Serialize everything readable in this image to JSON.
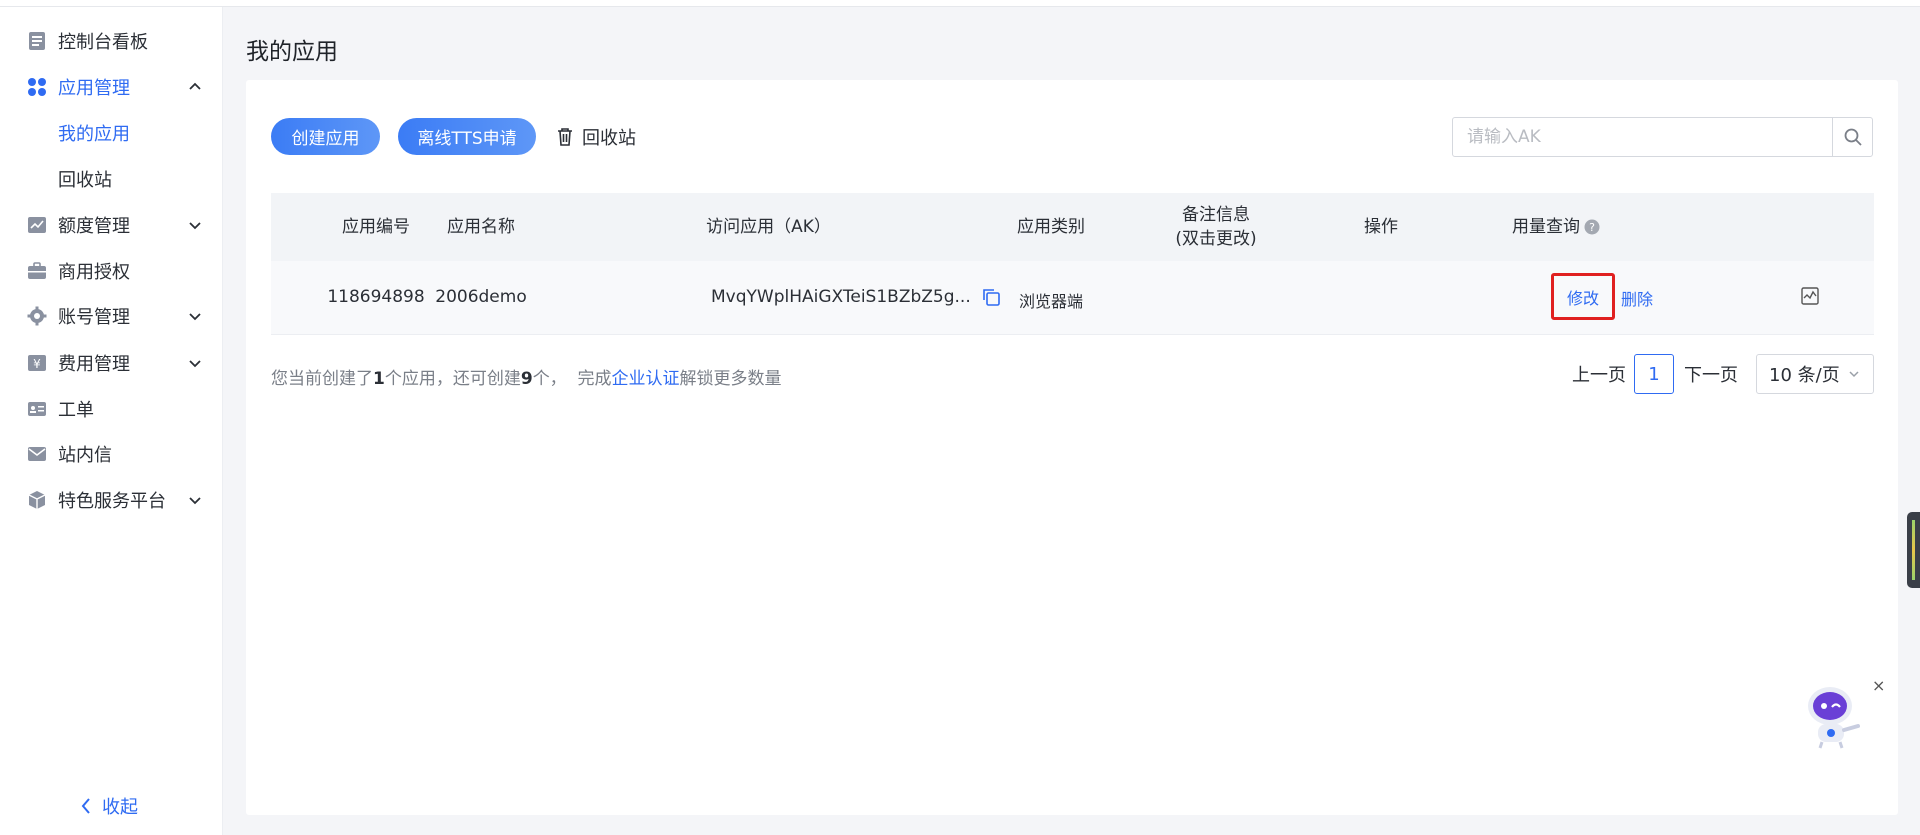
{
  "sidebar": {
    "items": [
      {
        "label": "控制台看板",
        "icon": "document-icon"
      },
      {
        "label": "应用管理",
        "icon": "apps-grid-icon",
        "expanded": true
      },
      {
        "label": "我的应用",
        "sub": true
      },
      {
        "label": "回收站",
        "sub": true
      },
      {
        "label": "额度管理",
        "icon": "chart-icon"
      },
      {
        "label": "商用授权",
        "icon": "briefcase-icon"
      },
      {
        "label": "账号管理",
        "icon": "gear-icon"
      },
      {
        "label": "费用管理",
        "icon": "yen-icon"
      },
      {
        "label": "工单",
        "icon": "id-card-icon"
      },
      {
        "label": "站内信",
        "icon": "mail-icon"
      },
      {
        "label": "特色服务平台",
        "icon": "cube-icon"
      }
    ],
    "collapse_label": "收起"
  },
  "page_title": "我的应用",
  "toolbar": {
    "create_label": "创建应用",
    "tts_label": "离线TTS申请",
    "recycle_label": "回收站",
    "search_placeholder": "请输入AK"
  },
  "table": {
    "headers": [
      "应用编号",
      "应用名称",
      "访问应用（AK）",
      "应用类别",
      "备注信息",
      "(双击更改)",
      "操作",
      "用量查询"
    ],
    "rows": [
      {
        "id": "118694898",
        "name": "2006demo",
        "ak": "MvqYWplHAiGXTeiS1BZbZ5g...",
        "category": "浏览器端",
        "remark": "",
        "edit_label": "修改",
        "delete_label": "删除"
      }
    ]
  },
  "footer": {
    "info_prefix": "您当前创建了",
    "created_count": "1",
    "info_mid": "个应用，还可创建",
    "remaining_count": "9",
    "info_suffix": "个，  完成",
    "info_link": "企业认证",
    "info_end": "解锁更多数量"
  },
  "pagination": {
    "prev_label": "上一页",
    "current_page": "1",
    "next_label": "下一页",
    "page_size": "10 条/页"
  },
  "colors": {
    "accent": "#2f6bf2",
    "highlight_box": "#e02020"
  }
}
